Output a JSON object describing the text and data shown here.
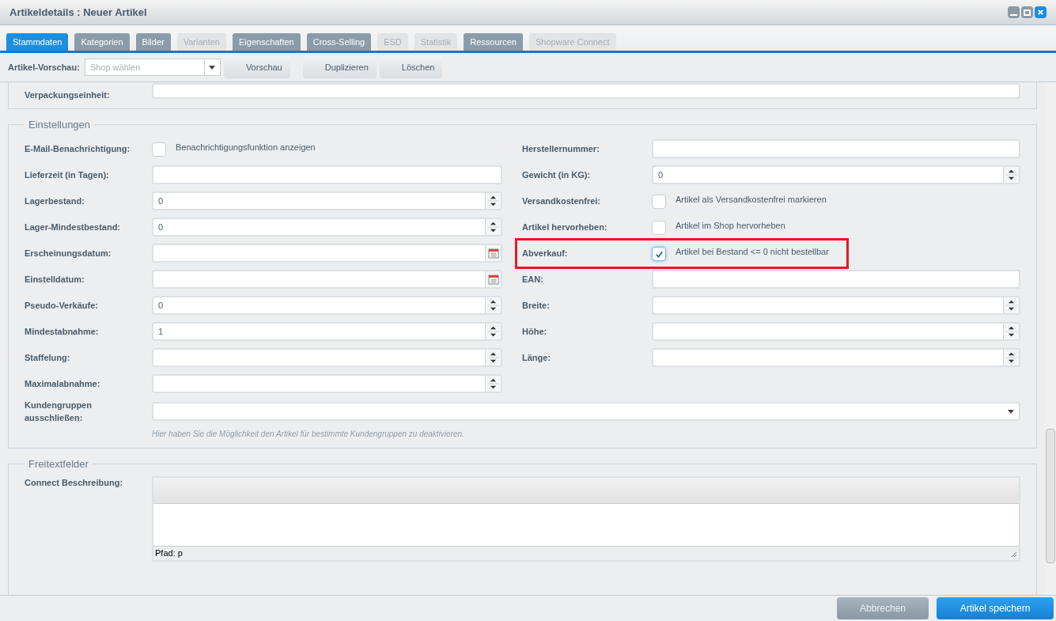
{
  "window": {
    "title": "Artikeldetails : Neuer Artikel"
  },
  "tabs": [
    {
      "label": "Stammdaten",
      "selected": true,
      "disabled": false
    },
    {
      "label": "Kategorien",
      "selected": false,
      "disabled": false
    },
    {
      "label": "Bilder",
      "selected": false,
      "disabled": false
    },
    {
      "label": "Varianten",
      "selected": false,
      "disabled": true
    },
    {
      "label": "Eigenschaften",
      "selected": false,
      "disabled": false
    },
    {
      "label": "Cross-Selling",
      "selected": false,
      "disabled": false
    },
    {
      "label": "ESD",
      "selected": false,
      "disabled": true
    },
    {
      "label": "Statistik",
      "selected": false,
      "disabled": true
    },
    {
      "label": "Ressourcen",
      "selected": false,
      "disabled": false
    },
    {
      "label": "Shopware Connect",
      "selected": false,
      "disabled": true
    }
  ],
  "toolbar": {
    "label": "Artikel-Vorschau:",
    "shop_select": {
      "placeholder": "Shop wählen"
    },
    "buttons": [
      "Vorschau",
      "Duplizieren",
      "Löschen"
    ]
  },
  "top_field": {
    "label": "Verpackungseinheit:"
  },
  "settings": {
    "title": "Einstellungen",
    "left": [
      {
        "kind": "checkbox",
        "label": "E-Mail-Benachrichtigung:",
        "text": "Benachrichtigungsfunktion anzeigen",
        "checked": false
      },
      {
        "kind": "text",
        "label": "Lieferzeit (in Tagen):"
      },
      {
        "kind": "number",
        "label": "Lagerbestand:",
        "value": "0"
      },
      {
        "kind": "number",
        "label": "Lager-Mindestbestand:",
        "value": "0"
      },
      {
        "kind": "date",
        "label": "Erscheinungsdatum:"
      },
      {
        "kind": "date",
        "label": "Einstelldatum:"
      },
      {
        "kind": "number",
        "label": "Pseudo-Verkäufe:",
        "value": "0"
      },
      {
        "kind": "number",
        "label": "Mindestabnahme:",
        "value": "1"
      },
      {
        "kind": "number",
        "label": "Staffelung:"
      },
      {
        "kind": "number",
        "label": "Maximalabnahme:"
      }
    ],
    "right": [
      {
        "kind": "text",
        "label": "Herstellernummer:"
      },
      {
        "kind": "number",
        "label": "Gewicht (in KG):",
        "value": "0"
      },
      {
        "kind": "checkbox",
        "label": "Versandkostenfrei:",
        "text": "Artikel als Versandkostenfrei markieren",
        "checked": false
      },
      {
        "kind": "checkbox",
        "label": "Artikel hervorheben:",
        "text": "Artikel im Shop hervorheben",
        "checked": false
      },
      {
        "kind": "checkbox",
        "label": "Abverkauf:",
        "text": "Artikel bei Bestand <= 0 nicht bestellbar",
        "checked": true,
        "highlighted": true
      },
      {
        "kind": "text",
        "label": "EAN:"
      },
      {
        "kind": "number",
        "label": "Breite:"
      },
      {
        "kind": "number",
        "label": "Höhe:"
      },
      {
        "kind": "number",
        "label": "Länge:"
      }
    ],
    "customer_groups": {
      "label": "Kundengruppen ausschließen:",
      "hint": "Hier haben Sie die Möglichkeit den Artikel für bestimmte Kundengruppen zu deaktivieren."
    }
  },
  "freetext": {
    "title": "Freitextfelder",
    "label": "Connect Beschreibung:",
    "path": "Pfad: p"
  },
  "footer": {
    "buttons": [
      {
        "label": "Abbrechen",
        "kind": "secondary"
      },
      {
        "label": "Artikel speichern",
        "kind": "primary"
      }
    ]
  }
}
